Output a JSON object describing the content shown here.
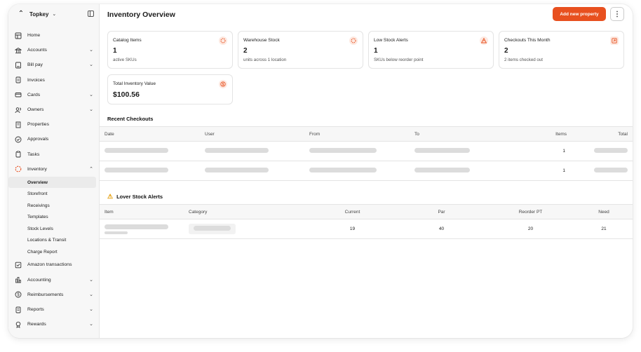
{
  "brand": {
    "name": "Topkey"
  },
  "sidebar": {
    "items": [
      {
        "label": "Home",
        "icon": "grid-icon"
      },
      {
        "label": "Accounts",
        "icon": "bank-icon",
        "expandable": true
      },
      {
        "label": "Bill pay",
        "icon": "bill-icon",
        "expandable": true
      },
      {
        "label": "Invoices",
        "icon": "invoice-icon"
      },
      {
        "label": "Cards",
        "icon": "card-icon",
        "expandable": true
      },
      {
        "label": "Owners",
        "icon": "users-icon",
        "expandable": true
      },
      {
        "label": "Properties",
        "icon": "building-icon"
      },
      {
        "label": "Approvals",
        "icon": "check-circle-icon"
      },
      {
        "label": "Tasks",
        "icon": "tasks-icon"
      },
      {
        "label": "Inventory",
        "icon": "inventory-icon",
        "expanded": true
      }
    ],
    "inventory_sub": [
      "Overview",
      "Storefront",
      "Receivings",
      "Templates",
      "Stock Levels",
      "Locations & Transit",
      "Charge Report"
    ],
    "items_after": [
      {
        "label": "Amazon transactions",
        "icon": "checkbox-icon"
      },
      {
        "label": "Accounting",
        "icon": "chart-bar-icon",
        "expandable": true
      },
      {
        "label": "Reimbursements",
        "icon": "dollar-icon",
        "expandable": true
      },
      {
        "label": "Reports",
        "icon": "report-icon",
        "expandable": true
      },
      {
        "label": "Rewards",
        "icon": "award-icon",
        "expandable": true
      }
    ]
  },
  "header": {
    "title": "Inventory Overview",
    "add_button": "Add new property"
  },
  "cards": [
    {
      "title": "Catalog Items",
      "value": "1",
      "sub": "active SKUs"
    },
    {
      "title": "Warehouse Stock",
      "value": "2",
      "sub": "units across 1 location"
    },
    {
      "title": "Low Stock Alerts",
      "value": "1",
      "sub": "SKUs below reorder point"
    },
    {
      "title": "Checkouts This Month",
      "value": "2",
      "sub": "2 items checked out"
    },
    {
      "title": "Total Inventory Value",
      "value": "$100.56",
      "sub": ""
    }
  ],
  "checkouts": {
    "title": "Recent Checkouts",
    "columns": [
      "Date",
      "User",
      "From",
      "To",
      "Items",
      "Total"
    ],
    "rows": [
      {
        "items": "1"
      },
      {
        "items": "1"
      }
    ]
  },
  "alerts": {
    "title": "Lover Stock Alerts",
    "columns": [
      "Item",
      "Category",
      "Current",
      "Par",
      "Reorder PT",
      "Need"
    ],
    "rows": [
      {
        "current": "19",
        "par": "40",
        "reorder": "20",
        "need": "21"
      }
    ]
  },
  "colors": {
    "accent": "#e8501f",
    "warning": "#e39a00"
  }
}
